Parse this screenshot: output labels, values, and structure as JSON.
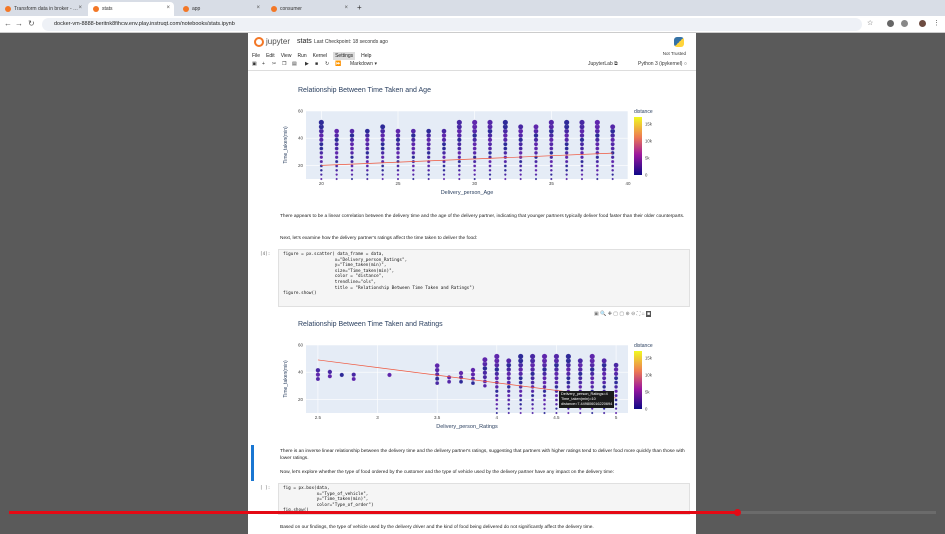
{
  "browser": {
    "tabs": [
      {
        "label": "Transform data in broker - …",
        "x": 0
      },
      {
        "label": "stats",
        "x": 88,
        "active": true
      },
      {
        "label": "app",
        "x": 178
      },
      {
        "label": "consumer",
        "x": 266
      }
    ],
    "url": "docker-vm-8888-beritnk8fihcw.env.play.instruqt.com/notebooks/stats.ipynb"
  },
  "jupyter": {
    "brand": "jupyter",
    "notebook_name": "stats",
    "checkpoint": "Last Checkpoint: 18 seconds ago",
    "trust": "Not Trusted",
    "menu": [
      "File",
      "Edit",
      "View",
      "Run",
      "Kernel",
      "Settings",
      "Help"
    ],
    "cell_type": "Markdown",
    "jupyterlab_label": "JupyterLab",
    "kernel": "Python 3 (ipykernel)"
  },
  "plot1": {
    "title": "Relationship Between Time Taken and Age",
    "xlabel": "Delivery_person_Age",
    "ylabel": "Time_taken(min)",
    "legend_title": "distance"
  },
  "text1": "There appears to be a linear correlation between the delivery time and the age of the delivery partner, indicating that younger partners typically deliver food faster than their older counterparts.",
  "text2": "Next, let's examine how the delivery partner's ratings affect the time taken to deliver the food:",
  "cell2": {
    "prompt": "[4]:",
    "lines": [
      "figure = px.scatter( data_frame = data,",
      "                    x=\"Delivery_person_Ratings\",",
      "                    y=\"Time_taken(min)\",",
      "                    size=\"Time_taken(min)\",",
      "                    color = \"distance\",",
      "                    trendline=\"ols\",",
      "                    title = \"Relationship Between Time Taken and Ratings\")",
      "figure.show()"
    ]
  },
  "plot2": {
    "title": "Relationship Between Time Taken and Ratings",
    "xlabel": "Delivery_person_Ratings",
    "ylabel": "Time_taken(min)",
    "legend_title": "distance",
    "tooltip": [
      "Delivery_person_Ratings=4",
      "Time_taken(min)=10",
      "distance=7.449806016220694"
    ]
  },
  "text3": "There is an inverse linear relationship between the delivery time and the delivery partner's ratings, suggesting that partners with higher ratings tend to deliver food more quickly than those with lower ratings.",
  "text4": "Now, let's explore whether the type of food ordered by the customer and the type of vehicle used by the delivery partner have any impact on the delivery time:",
  "cell3": {
    "prompt": "[ ]:",
    "lines": [
      "fig = px.box(data,",
      "             x=\"Type_of_vehicle\",",
      "             y=\"Time_taken(min)\",",
      "             color=\"Type_of_order\")",
      "fig.show()"
    ]
  },
  "text5": "Based on our findings, the type of vehicle used by the delivery driver and the kind of food being delivered do not significantly affect the delivery time.",
  "video": {
    "progress": 0.785
  },
  "chart_data": [
    {
      "type": "scatter",
      "title": "Relationship Between Time Taken and Age",
      "xlabel": "Delivery_person_Age",
      "ylabel": "Time_taken(min)",
      "xlim": [
        19,
        40
      ],
      "ylim": [
        10,
        60
      ],
      "xticks": [
        20,
        25,
        30,
        35,
        40
      ],
      "yticks": [
        20,
        40,
        60
      ],
      "x_values": [
        20,
        21,
        22,
        23,
        24,
        25,
        26,
        27,
        28,
        29,
        30,
        31,
        32,
        33,
        34,
        35,
        36,
        37,
        38,
        39
      ],
      "y_min": [
        10,
        10,
        10,
        10,
        10,
        10,
        10,
        10,
        10,
        10,
        10,
        10,
        10,
        10,
        10,
        10,
        10,
        10,
        10,
        10
      ],
      "y_max": [
        54,
        47,
        46,
        48,
        50,
        46,
        48,
        46,
        48,
        52,
        52,
        54,
        52,
        50,
        50,
        54,
        54,
        52,
        54,
        50
      ],
      "trendline": [
        [
          20,
          20
        ],
        [
          39,
          29
        ]
      ],
      "colorbar": {
        "title": "distance",
        "ticks": [
          "15k",
          "10k",
          "5k",
          "0"
        ]
      }
    },
    {
      "type": "scatter",
      "title": "Relationship Between Time Taken and Ratings",
      "xlabel": "Delivery_person_Ratings",
      "ylabel": "Time_taken(min)",
      "xlim": [
        2.4,
        5.1
      ],
      "ylim": [
        10,
        60
      ],
      "xticks": [
        2.5,
        3,
        3.5,
        4,
        4.5,
        5
      ],
      "yticks": [
        20,
        40,
        60
      ],
      "x_values": [
        2.5,
        2.6,
        2.7,
        2.8,
        3.1,
        3.5,
        3.6,
        3.7,
        3.8,
        3.9,
        4.0,
        4.1,
        4.2,
        4.3,
        4.4,
        4.5,
        4.6,
        4.7,
        4.8,
        4.9,
        5.0
      ],
      "y_min": [
        35,
        37,
        38,
        35,
        38,
        32,
        33,
        33,
        32,
        30,
        10,
        10,
        10,
        10,
        10,
        10,
        10,
        10,
        10,
        10,
        10
      ],
      "y_max": [
        42,
        42,
        40,
        40,
        40,
        48,
        38,
        42,
        44,
        50,
        52,
        50,
        52,
        54,
        52,
        54,
        52,
        50,
        52,
        50,
        48
      ],
      "trendline": [
        [
          2.5,
          49
        ],
        [
          5.0,
          21
        ]
      ],
      "colorbar": {
        "title": "distance",
        "ticks": [
          "15k",
          "10k",
          "5k",
          "0"
        ]
      }
    }
  ]
}
